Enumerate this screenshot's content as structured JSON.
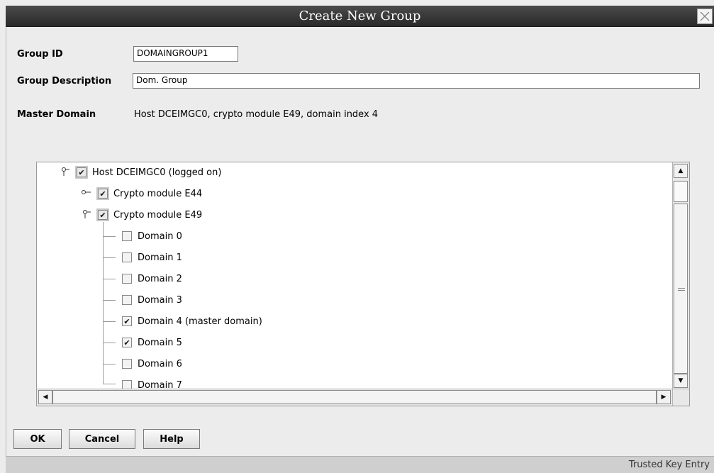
{
  "window": {
    "title": "Create New Group",
    "close_icon": "close-icon"
  },
  "form": {
    "group_id_label": "Group ID",
    "group_id_value": "DOMAINGROUP1",
    "group_desc_label": "Group Description",
    "group_desc_value": "Dom. Group",
    "master_domain_label": "Master Domain",
    "master_domain_value": "Host DCEIMGC0, crypto module E49, domain index 4"
  },
  "tree": {
    "nodes": [
      {
        "label": "Host DCEIMGC0 (logged on)",
        "checked": true,
        "expanded": true
      },
      {
        "label": "Crypto module E44",
        "checked": true,
        "expanded": false
      },
      {
        "label": "Crypto module E49",
        "checked": true,
        "expanded": true
      },
      {
        "label": "Domain 0",
        "checked": false
      },
      {
        "label": "Domain 1",
        "checked": false
      },
      {
        "label": "Domain 2",
        "checked": false
      },
      {
        "label": "Domain 3",
        "checked": false
      },
      {
        "label": "Domain 4 (master domain)",
        "checked": true
      },
      {
        "label": "Domain 5",
        "checked": true
      },
      {
        "label": "Domain 6",
        "checked": false
      },
      {
        "label": "Domain 7",
        "checked": false
      }
    ]
  },
  "buttons": {
    "ok": "OK",
    "cancel": "Cancel",
    "help": "Help"
  },
  "status": {
    "text": "Trusted Key Entry"
  }
}
